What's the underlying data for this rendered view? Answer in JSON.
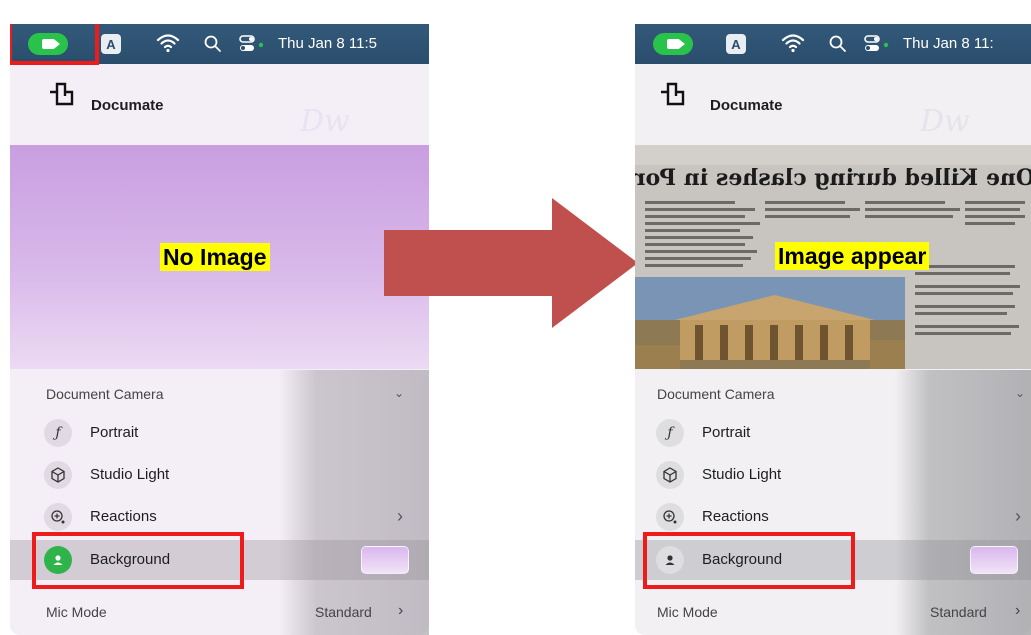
{
  "menubar": {
    "a_label": "A",
    "clock": "Thu Jan 8 11:5"
  },
  "menubar_right": {
    "clock": "Thu Jan 8 11:"
  },
  "app": {
    "title": "Documate"
  },
  "preview": {
    "left_label": "No Image",
    "right_label": "Image appear",
    "newspaper_headline": "One Killed during clashes in Portland"
  },
  "section": {
    "label": "Document Camera"
  },
  "effects": [
    {
      "icon": "portrait-icon",
      "label": "Portrait"
    },
    {
      "icon": "studio-light-icon",
      "label": "Studio Light"
    },
    {
      "icon": "reactions-icon",
      "label": "Reactions"
    },
    {
      "icon": "background-icon",
      "label": "Background"
    }
  ],
  "mic": {
    "label": "Mic Mode",
    "value": "Standard"
  },
  "colors": {
    "annotation_red": "#ee1b1b",
    "arrow": "#c0504d",
    "highlight": "#ffff00",
    "menubar": "#2a4d6c",
    "camera_active_green": "#29c24a"
  }
}
